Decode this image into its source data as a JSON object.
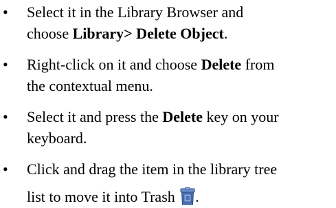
{
  "bullet_symbol": "•",
  "items": [
    {
      "line1_pre": "Select it in the Library Browser and",
      "line2_pre": "choose ",
      "line2_bold": "Library> Delete Object",
      "line2_post": "."
    },
    {
      "line1_pre": "Right-click on it and choose ",
      "line1_bold": "Delete",
      "line1_post": " from",
      "line2_pre": "the contextual menu."
    },
    {
      "line1_pre": "Select it and press the ",
      "line1_bold": "Delete",
      "line1_post": " key on your",
      "line2_pre": "keyboard."
    },
    {
      "line1_pre": "Click and drag the item in the library tree",
      "line2_pre": "list to move it into Trash ",
      "line2_post": ".",
      "icon": "trash-icon"
    }
  ],
  "colors": {
    "text": "#000000",
    "icon_body": "#4a73b8",
    "icon_light": "#9db8e2",
    "icon_dark": "#27467f"
  }
}
